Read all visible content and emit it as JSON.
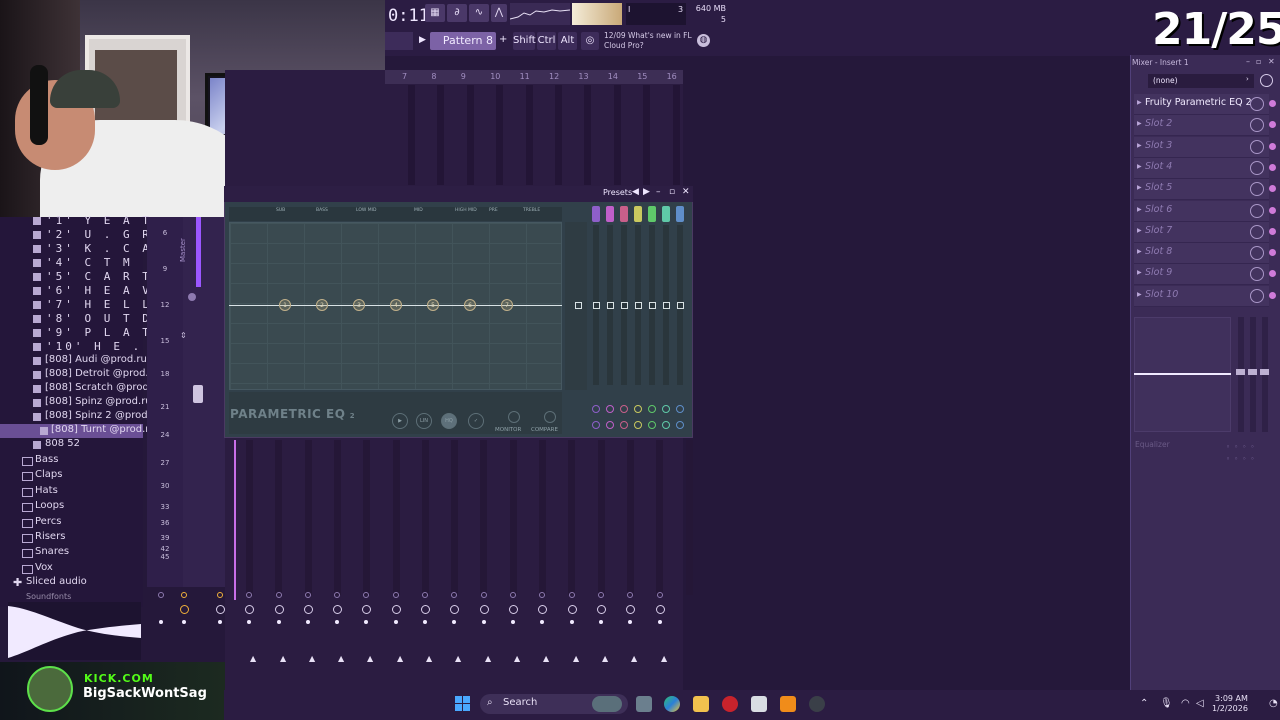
{
  "counter": "21/25",
  "toolbar": {
    "time": "0:11",
    "cpu_label": "3",
    "memory": "640 MB",
    "memory_sub": "5",
    "pattern": "Pattern 8",
    "pattern_arrow": "+",
    "mod_shift": "Shift",
    "mod_ctrl": "Ctrl",
    "mod_alt": "Alt",
    "news_date": "12/09",
    "news_text": "What's new in FL Cloud Pro?"
  },
  "browser": {
    "packs": [
      "'1' Y E A T",
      "'2' U . G R O U N D",
      "'3' K . C A R S O N",
      "'4' C T M",
      "'5' C A R T I",
      "'6' H E A V E N",
      "'7' H E L L",
      "'8' O U T D O O R",
      "'9' P L A T E",
      "'10' H E . H E L L"
    ],
    "files": [
      "[808] Audi @prod.rude",
      "[808] Detroit @prod.rude",
      "[808] Scratch @prod.rude",
      "[808] Spinz @prod.rude",
      "[808] Spinz 2 @prod.rude",
      "[808] Turnt @prod.rude",
      "808 52"
    ],
    "folders": [
      "Bass",
      "Claps",
      "Hats",
      "Loops",
      "Percs",
      "Risers",
      "Snares",
      "Vox"
    ],
    "sliced": "Sliced audio",
    "soundfonts": "Soundfonts"
  },
  "rack": {
    "numbers": [
      "6",
      "9",
      "12",
      "15",
      "18",
      "21",
      "24",
      "27",
      "30",
      "33",
      "36",
      "39",
      "42",
      "45"
    ],
    "master": "Master"
  },
  "sequencer": {
    "ruler": [
      "7",
      "8",
      "9",
      "10",
      "11",
      "12",
      "13",
      "14",
      "15",
      "16"
    ]
  },
  "eq": {
    "presets": "Presets",
    "tabs": [
      "SUB",
      "BASS",
      "LOW MID",
      "MID",
      "HIGH MID",
      "PRE",
      "TREBLE"
    ],
    "nodes": [
      "1",
      "2",
      "3",
      "4",
      "5",
      "6",
      "7"
    ],
    "band_colors": [
      "#8e5fc9",
      "#c05fc9",
      "#c95f8a",
      "#c9c95f",
      "#5fc96a",
      "#5fc9a8",
      "#5f8ec9"
    ],
    "name": "PARAMETRIC EQ",
    "name_suffix": "2",
    "lin": "LIN",
    "monitor": "MONITOR",
    "compare": "COMPARE"
  },
  "mixer": {
    "title": "Mixer - Insert 1",
    "selector": "(none)",
    "slots": [
      "Fruity Parametric EQ 2",
      "Slot 2",
      "Slot 3",
      "Slot 4",
      "Slot 5",
      "Slot 6",
      "Slot 7",
      "Slot 8",
      "Slot 9",
      "Slot 10"
    ],
    "eq_label": "Equalizer"
  },
  "overlay": {
    "platform": "KICK.COM",
    "username": "BigSackWontSag"
  },
  "taskbar": {
    "search": "Search",
    "time": "3:09 AM",
    "date": "1/2/2026"
  }
}
